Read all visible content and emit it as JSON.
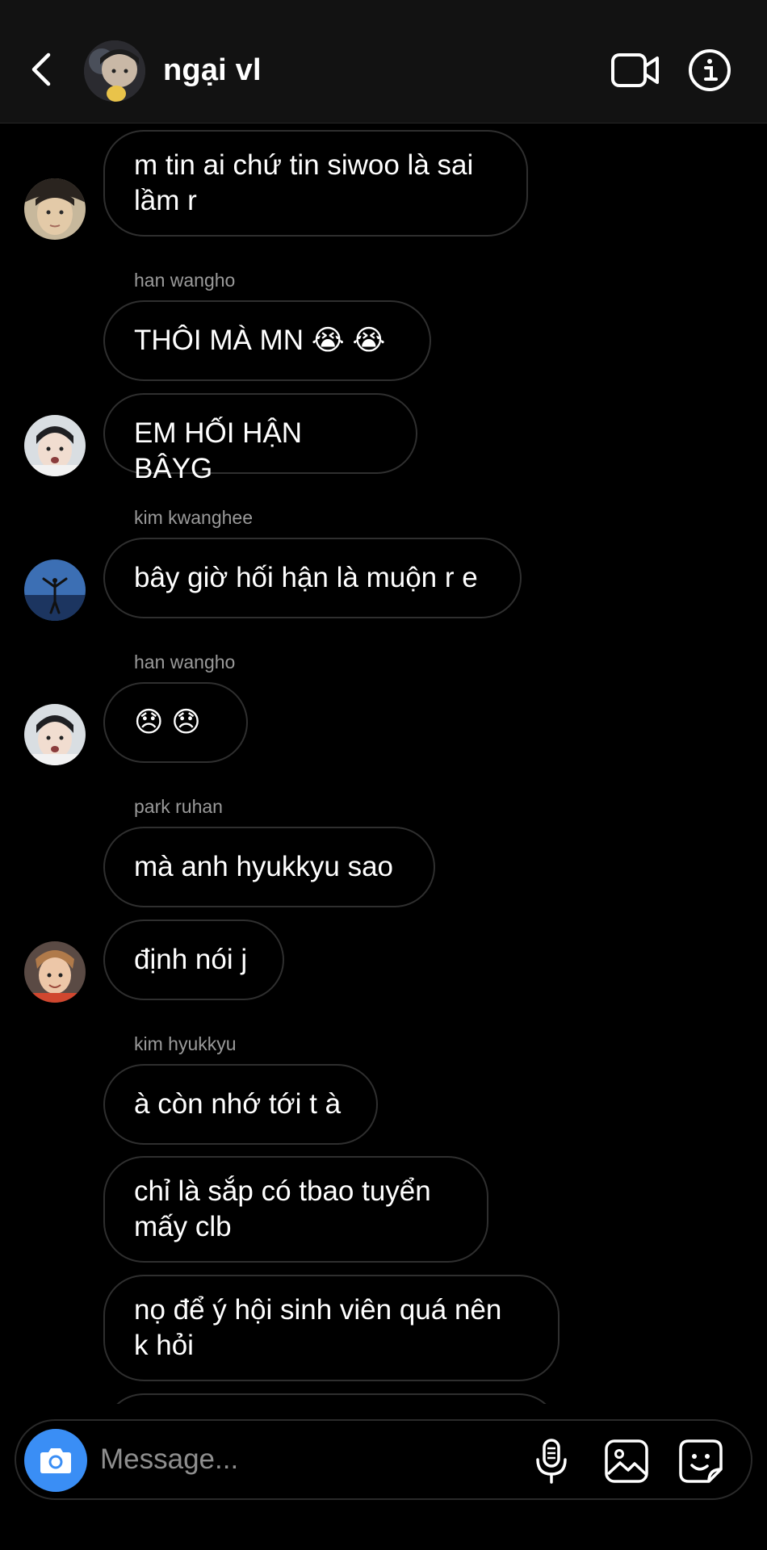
{
  "header": {
    "title": "ngại vl",
    "back_icon": "chevron-left-icon",
    "video_icon": "video-camera-icon",
    "info_icon": "info-icon"
  },
  "messages": [
    {
      "text": "m tin ai chứ tin siwoo là sai\nlầm r"
    },
    {
      "sender": "han wangho",
      "text": "THÔI MÀ MN 😭 😭"
    },
    {
      "text": "EM HỐI HẬN BÂYG"
    },
    {
      "sender": "kim kwanghee",
      "text": "bây giờ hối hận là muộn r e"
    },
    {
      "sender": "han wangho",
      "text": "😞 😞"
    },
    {
      "sender": "park ruhan",
      "text": "mà anh hyukkyu sao"
    },
    {
      "text": "định nói j"
    },
    {
      "sender": "kim hyukkyu",
      "text": "à còn nhớ tới t à"
    },
    {
      "text": "chỉ là sắp có tbao tuyển\nmấy clb"
    },
    {
      "text": "nọ để ý hội sinh viên quá nên\nk hỏi"
    }
  ],
  "composer": {
    "placeholder": "Message...",
    "camera_icon": "camera-icon",
    "mic_icon": "microphone-icon",
    "gallery_icon": "gallery-icon",
    "sticker_icon": "sticker-icon"
  },
  "colors": {
    "background": "#000000",
    "header_background": "#121212",
    "bubble_border": "#2f2f2f",
    "sender_name": "#9a9a9a",
    "camera_button": "#3a8ef5",
    "placeholder": "#8e8e8e"
  }
}
